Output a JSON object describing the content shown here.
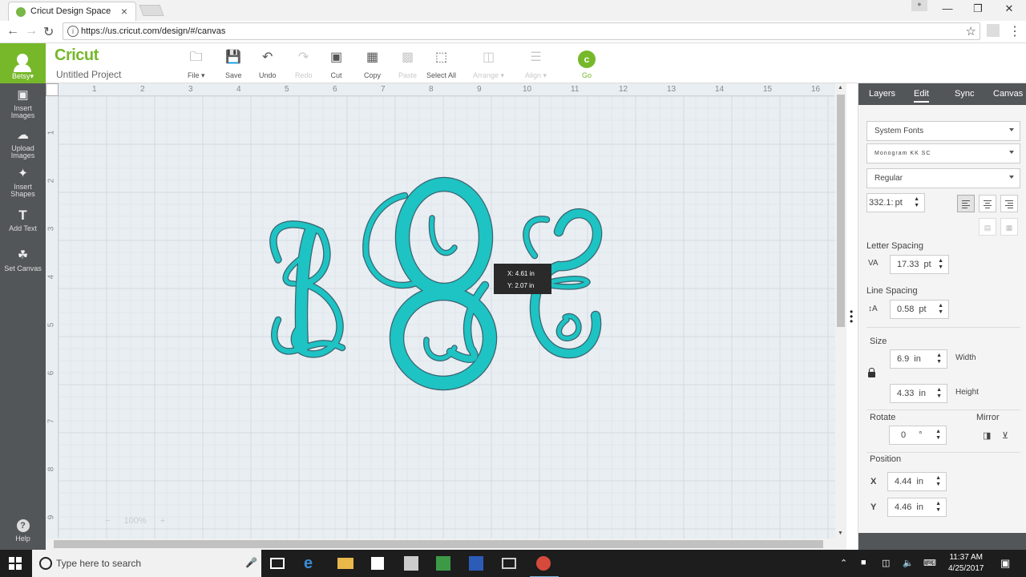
{
  "browser": {
    "tab_title": "Cricut Design Space",
    "url": "https://us.cricut.com/design/#/canvas"
  },
  "header": {
    "user_name": "Betsy",
    "logo": "Cricut",
    "project_name": "Untitled Project",
    "tools": {
      "file": "File",
      "save": "Save",
      "undo": "Undo",
      "redo": "Redo",
      "cut": "Cut",
      "copy": "Copy",
      "paste": "Paste",
      "select_all": "Select All",
      "arrange": "Arrange",
      "align": "Align",
      "go": "Go"
    }
  },
  "sidebar": {
    "insert_images_1": "Insert",
    "insert_images_2": "Images",
    "upload_images_1": "Upload",
    "upload_images_2": "Images",
    "insert_shapes_1": "Insert",
    "insert_shapes_2": "Shapes",
    "add_text": "Add Text",
    "set_canvas": "Set Canvas",
    "help": "Help"
  },
  "canvas": {
    "ruler_h": [
      "1",
      "2",
      "3",
      "4",
      "5",
      "6",
      "7",
      "8",
      "9",
      "10",
      "11",
      "12",
      "13",
      "14",
      "15",
      "16"
    ],
    "ruler_v": [
      "1",
      "2",
      "3",
      "4",
      "5",
      "6",
      "7",
      "8",
      "9"
    ],
    "zoom_minus": "−",
    "zoom_level": "100%",
    "zoom_plus": "+",
    "tooltip_x": "X: 4.61 in",
    "tooltip_y": "Y: 2.07 in",
    "design_color": "#1ec3c3",
    "design_stroke": "#3a6470"
  },
  "panel": {
    "tabs": {
      "layers": "Layers",
      "edit": "Edit",
      "sync": "Sync",
      "canvas": "Canvas"
    },
    "font_source": "System Fonts",
    "font_name": "Monogram KK SC",
    "font_style": "Regular",
    "font_size": "332.1:",
    "font_size_unit": "pt",
    "letter_spacing_label": "Letter Spacing",
    "letter_spacing_value": "17.33",
    "letter_spacing_unit": "pt",
    "line_spacing_label": "Line Spacing",
    "line_spacing_value": "0.58",
    "line_spacing_unit": "pt",
    "size_label": "Size",
    "width_value": "6.9",
    "width_unit": "in",
    "width_label": "Width",
    "height_value": "4.33",
    "height_unit": "in",
    "height_label": "Height",
    "rotate_label": "Rotate",
    "rotate_value": "0",
    "rotate_unit": "°",
    "mirror_label": "Mirror",
    "position_label": "Position",
    "x_label": "X",
    "x_value": "4.44",
    "x_unit": "in",
    "y_label": "Y",
    "y_value": "4.46",
    "y_unit": "in"
  },
  "taskbar": {
    "search_placeholder": "Type here to search",
    "time": "11:37 AM",
    "date": "4/25/2017"
  }
}
